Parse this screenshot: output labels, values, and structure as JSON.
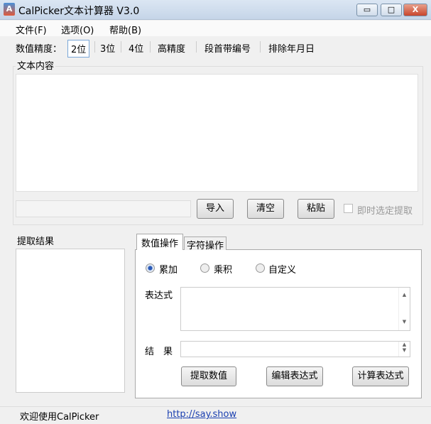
{
  "window": {
    "title": "CalPicker文本计算器 V3.0",
    "minimize": "▭",
    "maximize": "□",
    "close": "X"
  },
  "menu": [
    "文件(F)",
    "选项(O)",
    "帮助(B)"
  ],
  "toolbar": {
    "precision_label": "数值精度：",
    "options": [
      "2位",
      "3位",
      "4位",
      "高精度"
    ],
    "paragraph_number": "段首带编号",
    "exclude_date": "排除年月日",
    "active": "2位"
  },
  "text_group": {
    "title": "文本内容",
    "import": "导入",
    "clear": "清空",
    "paste": "粘贴",
    "realtime_extract": "即时选定提取",
    "realtime_checked": false
  },
  "results": {
    "title": "提取结果"
  },
  "tabs": [
    "数值操作",
    "字符操作"
  ],
  "numeric": {
    "radios": [
      "累加",
      "乘积",
      "自定义"
    ],
    "selected": "累加",
    "expression_label": "表达式",
    "result_label": "结　果",
    "extract_button": "提取数值",
    "edit_button": "编辑表达式",
    "compute_button": "计算表达式"
  },
  "status": {
    "welcome": "欢迎使用CalPicker",
    "link": "http://say.show"
  }
}
